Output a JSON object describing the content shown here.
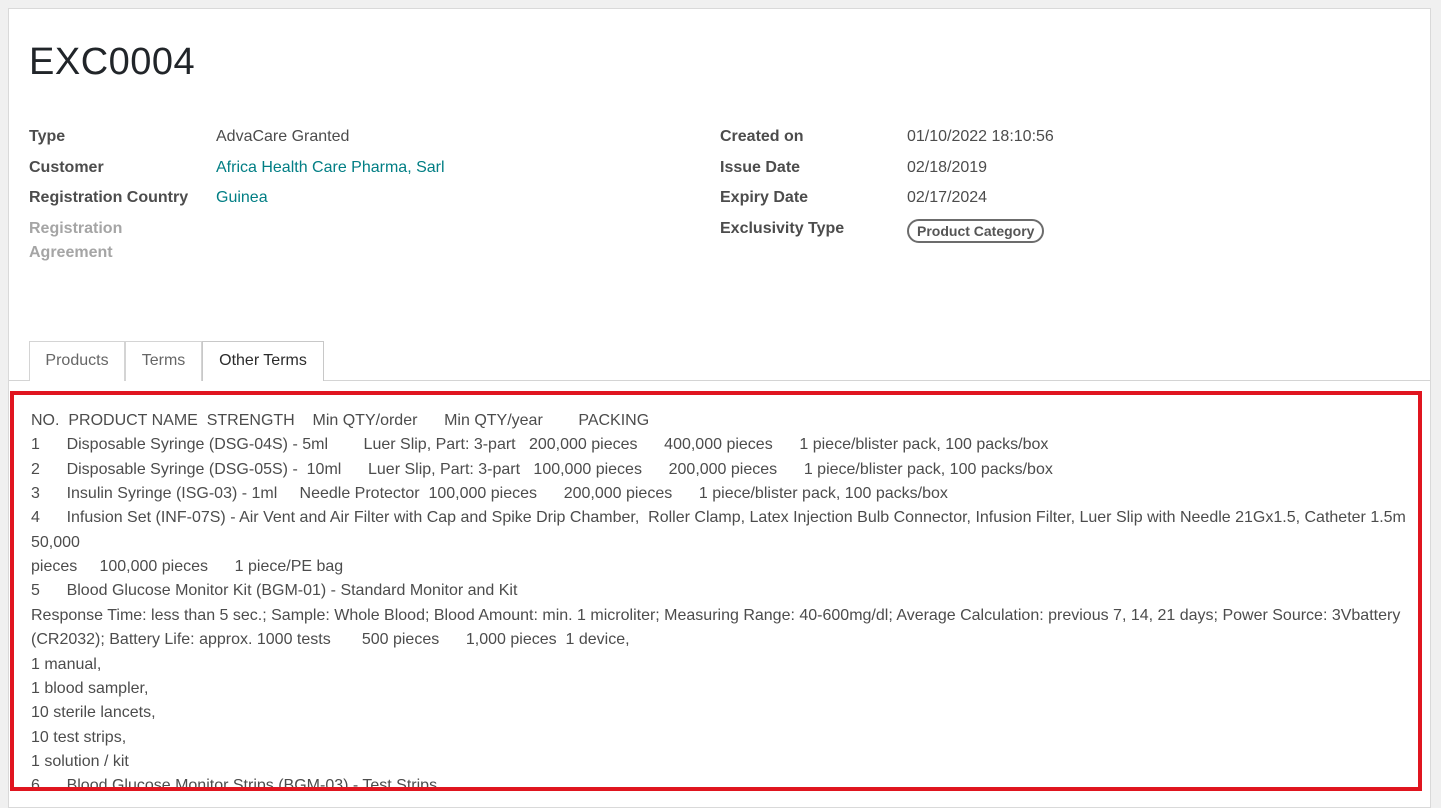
{
  "record": {
    "title": "EXC0004"
  },
  "fields": {
    "type_label": "Type",
    "type_value": "AdvaCare Granted",
    "customer_label": "Customer",
    "customer_value": "Africa Health Care Pharma, Sarl",
    "country_label": "Registration Country",
    "country_value": "Guinea",
    "agreement_label_1": "Registration",
    "agreement_label_2": "Agreement",
    "created_label": "Created on",
    "created_value": "01/10/2022 18:10:56",
    "issue_label": "Issue Date",
    "issue_value": "02/18/2019",
    "expiry_label": "Expiry Date",
    "expiry_value": "02/17/2024",
    "exclusivity_label": "Exclusivity Type",
    "exclusivity_value": "Product Category"
  },
  "tabs": [
    {
      "label": "Products"
    },
    {
      "label": "Terms"
    },
    {
      "label": "Other Terms"
    }
  ],
  "active_tab": "Other Terms",
  "other_terms": {
    "lines": [
      "NO.  PRODUCT NAME  STRENGTH    Min QTY/order      Min QTY/year        PACKING",
      "1      Disposable Syringe (DSG-04S) - 5ml        Luer Slip, Part: 3-part   200,000 pieces      400,000 pieces      1 piece/blister pack, 100 packs/box",
      "2      Disposable Syringe (DSG-05S) -  10ml      Luer Slip, Part: 3-part   100,000 pieces      200,000 pieces      1 piece/blister pack, 100 packs/box",
      "3      Insulin Syringe (ISG-03) - 1ml     Needle Protector  100,000 pieces      200,000 pieces      1 piece/blister pack, 100 packs/box",
      "4      Infusion Set (INF-07S) - Air Vent and Air Filter with Cap and Spike Drip Chamber,  Roller Clamp, Latex Injection Bulb Connector, Infusion Filter, Luer Slip with Needle 21Gx1.5, Catheter 1.5m",
      "50,000",
      "pieces     100,000 pieces      1 piece/PE bag",
      "5      Blood Glucose Monitor Kit (BGM-01) - Standard Monitor and Kit",
      "Response Time: less than 5 sec.; Sample: Whole Blood; Blood Amount: min. 1 microliter; Measuring Range: 40-600mg/dl; Average Calculation: previous 7, 14, 21 days; Power Source: 3Vbattery",
      "(CR2032); Battery Life: approx. 1000 tests       500 pieces      1,000 pieces  1 device,",
      "1 manual,",
      "1 blood sampler,",
      "10 sterile lancets,",
      "10 test strips,",
      "1 solution / kit",
      "6      Blood Glucose Monitor Strips (BGM-03) - Test Strips"
    ]
  },
  "colors": {
    "link": "#017e84",
    "highlight_border": "#e0151f"
  }
}
